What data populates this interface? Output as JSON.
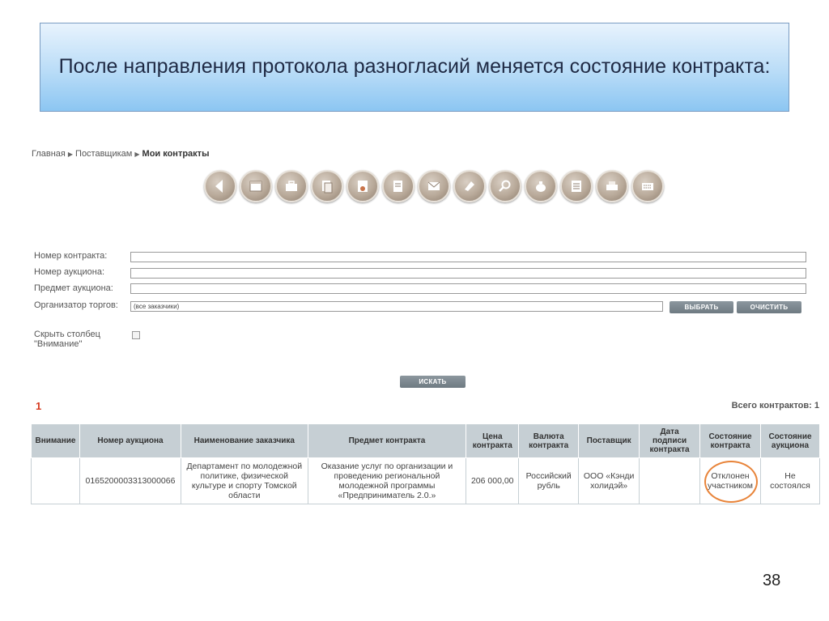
{
  "slide": {
    "title": "После направления протокола разногласий меняется состояние контракта:",
    "page_number": "38"
  },
  "breadcrumb": {
    "home": "Главная",
    "suppliers": "Поставщикам",
    "current": "Мои контракты"
  },
  "toolbar": {
    "icons": [
      "back-arrow-icon",
      "window-icon",
      "briefcase-icon",
      "documents-icon",
      "certificate-icon",
      "files-icon",
      "mail-icon",
      "tag-icon",
      "search-icon",
      "money-bag-icon",
      "list-icon",
      "printer-icon",
      "keyboard-icon"
    ]
  },
  "form": {
    "contract_number_label": "Номер контракта:",
    "contract_number_value": "",
    "auction_number_label": "Номер аукциона:",
    "auction_number_value": "",
    "auction_subject_label": "Предмет аукциона:",
    "auction_subject_value": "",
    "organizer_label": "Организатор торгов:",
    "organizer_value": "(все заказчики)",
    "select_button": "ВЫБРАТЬ",
    "clear_button": "ОЧИСТИТЬ",
    "hide_column_label_line1": "Скрыть столбец",
    "hide_column_label_line2": "\"Внимание\"",
    "search_button": "ИСКАТЬ"
  },
  "results": {
    "page": "1",
    "total_text": "Всего контрактов: 1"
  },
  "table": {
    "headers": [
      "Внимание",
      "Номер аукциона",
      "Наименование заказчика",
      "Предмет контракта",
      "Цена контракта",
      "Валюта контракта",
      "Поставщик",
      "Дата подписи контракта",
      "Состояние контракта",
      "Состояние аукциона"
    ],
    "rows": [
      [
        "",
        "0165200003313000066",
        "Департамент по молодежной политике, физической культуре и спорту Томской области",
        "Оказание услуг по организации и проведению региональной молодежной программы «Предприниматель 2.0.»",
        "206 000,00",
        "Российский рубль",
        "ООО «Кэнди холидэй»",
        "",
        "Отклонен участником",
        "Не состоялся"
      ]
    ]
  },
  "colors": {
    "highlight_circle": "#e8843a",
    "page_number": "#d63a1f",
    "header_bg": "#c6cfd4"
  }
}
